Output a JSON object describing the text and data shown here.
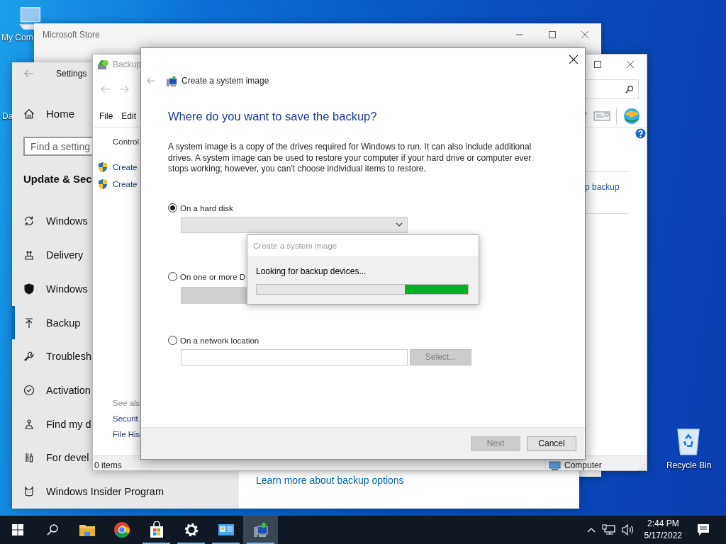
{
  "desktop_icons": [
    {
      "kind": "computer",
      "label": "My Com"
    },
    {
      "kind": "hidden",
      "label": "Da"
    },
    {
      "kind": "recycle_bin",
      "label": "Recycle Bin"
    }
  ],
  "store_window": {
    "title": "Microsoft Store"
  },
  "settings_window": {
    "title": "Settings",
    "home": "Home",
    "search": {
      "placeholder": "Find a setting"
    },
    "section": "Update & Sec",
    "nav": [
      {
        "kind": "sync",
        "label": "Windows",
        "selected": false
      },
      {
        "kind": "delivery",
        "label": "Delivery",
        "selected": false
      },
      {
        "kind": "shield",
        "label": "Windows",
        "selected": false
      },
      {
        "kind": "backup",
        "label": "Backup",
        "selected": true
      },
      {
        "kind": "wrench",
        "label": "Troublesh",
        "selected": false
      },
      {
        "kind": "check",
        "label": "Activation",
        "selected": false
      },
      {
        "kind": "locate",
        "label": "Find my d",
        "selected": false
      },
      {
        "kind": "tools",
        "label": "For devel",
        "selected": false
      },
      {
        "kind": "insider",
        "label": "Windows Insider Program",
        "selected": false
      }
    ],
    "link": "Learn more about backup options"
  },
  "backup_window": {
    "title": "Backup",
    "menu": [
      "File",
      "Edit"
    ],
    "breadcrumb": "Control",
    "tasks": [
      "Create",
      "Create"
    ],
    "link": "p backup",
    "see_also_heading": "See als",
    "see_also": [
      "Securit",
      "File His"
    ],
    "status": "0 items",
    "location": "Computer"
  },
  "dialog": {
    "title": "Create a system image",
    "heading": "Where do you want to save the backup?",
    "description": "A system image is a copy of the drives required for Windows to run. It can also include additional drives. A system image can be used to restore your computer if your hard drive or computer ever stops working; however, you can't choose individual items to restore.",
    "options": [
      {
        "kind": "dropdown",
        "label": "On a hard disk",
        "selected": true
      },
      {
        "kind": "list",
        "label": "On one or more D",
        "selected": false
      },
      {
        "kind": "path",
        "label": "On a network location",
        "selected": false,
        "button": "Select...",
        "button_disabled": true
      }
    ],
    "buttons": [
      {
        "label": "Next",
        "disabled": true
      },
      {
        "label": "Cancel",
        "disabled": false
      }
    ]
  },
  "progress_popup": {
    "title": "Create a system image",
    "message": "Looking for backup devices...",
    "level": 0.3
  },
  "taskbar": {
    "apps": [
      {
        "kind": "start",
        "running": false,
        "selected": false
      },
      {
        "kind": "search",
        "running": false,
        "selected": false
      },
      {
        "kind": "explorer",
        "running": false,
        "selected": false
      },
      {
        "kind": "chrome",
        "running": false,
        "selected": false
      },
      {
        "kind": "store",
        "running": true,
        "selected": false
      },
      {
        "kind": "settings",
        "running": true,
        "selected": false
      },
      {
        "kind": "control_panel",
        "running": true,
        "selected": false
      },
      {
        "kind": "backup",
        "running": true,
        "selected": true
      }
    ],
    "time": "2:44 PM",
    "date": "5/17/2022"
  }
}
